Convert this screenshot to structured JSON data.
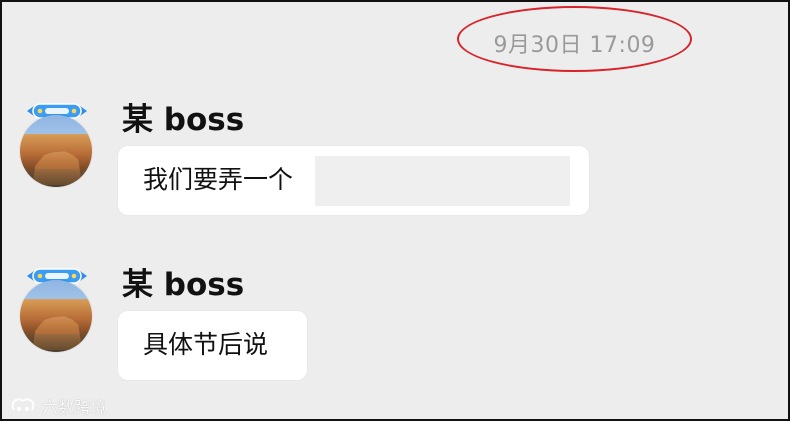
{
  "chat": {
    "timestamp": "9月30日 17:09",
    "messages": [
      {
        "sender": "某 boss",
        "text": "我们要弄一个",
        "avatar": {
          "badge_icon": "ribbon-badge-icon",
          "photo_icon": "cliff-landscape-avatar"
        }
      },
      {
        "sender": "某 boss",
        "text": "具体节后说",
        "avatar": {
          "badge_icon": "ribbon-badge-icon",
          "photo_icon": "cliff-landscape-avatar"
        }
      }
    ]
  },
  "watermark": {
    "text": "六数跨境",
    "icon": "brand-logo-icon"
  },
  "colors": {
    "background": "#ededed",
    "bubble": "#ffffff",
    "timestamp_text": "#9a9a9a",
    "highlight_circle": "#d8232a",
    "name_text": "#111111"
  }
}
